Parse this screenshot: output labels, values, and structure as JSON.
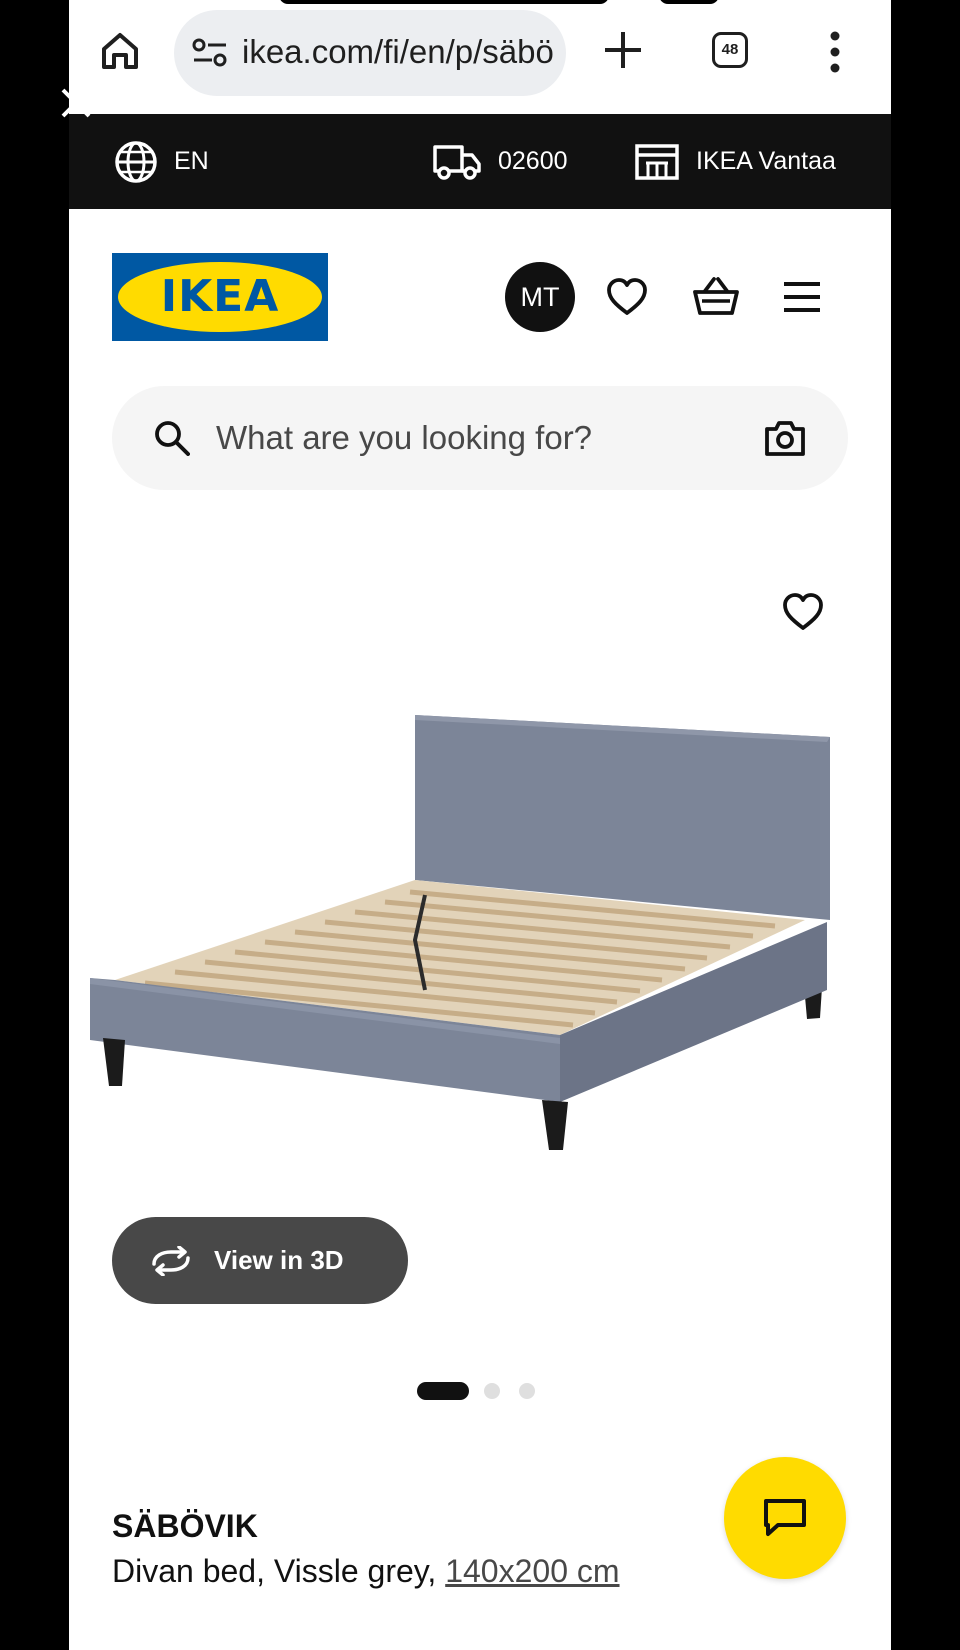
{
  "browser": {
    "url": "ikea.com/fi/en/p/säbövik-divan-bed",
    "tab_count": "48",
    "icons": [
      "home-icon",
      "site-settings-icon",
      "plus-icon",
      "tabs-icon",
      "more-vert-icon",
      "close-icon"
    ]
  },
  "topbar": {
    "language": "EN",
    "postcode": "02600",
    "store": "IKEA Vantaa"
  },
  "header": {
    "logo_text": "IKEA",
    "avatar_initials": "MT"
  },
  "search": {
    "placeholder": "What are you looking for?"
  },
  "product": {
    "view_3d_label": "View in 3D",
    "carousel": {
      "total": 3,
      "active": 1
    },
    "name": "SÄBÖVIK",
    "description": "Divan bed, Vissle grey,",
    "size": "140x200 cm"
  },
  "colors": {
    "ikea_blue": "#0058a3",
    "ikea_yellow": "#ffdb00",
    "topbar_bg": "#111111",
    "view3d_bg": "#484848"
  }
}
